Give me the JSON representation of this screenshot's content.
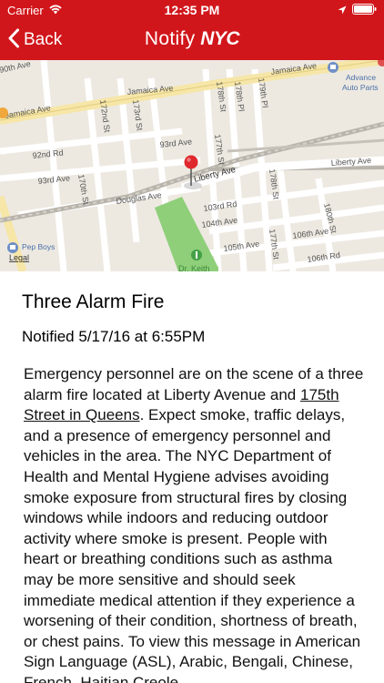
{
  "status": {
    "carrier": "Carrier",
    "time": "12:35 PM"
  },
  "nav": {
    "back_label": "Back",
    "title_light": "Notify",
    "title_bold": "NYC"
  },
  "map": {
    "labels": {
      "jamaica_ave_top": "Jamaica Ave",
      "jamaica_ave_mid": "Jamaica Ave",
      "jamaica_ave_left": "Jamaica Ave",
      "ave_90th": "90th Ave",
      "rd_92nd": "92nd Rd",
      "ave_93rd_left": "93rd Ave",
      "ave_93rd_mid": "93rd Ave",
      "douglas_ave": "Douglas Ave",
      "liberty_ave_mid": "Liberty Ave",
      "liberty_ave_right": "Liberty Ave",
      "st_170th": "170th St",
      "st_172nd": "172nd St",
      "st_173rd": "173rd St",
      "st_177th": "177th St",
      "st_178th": "178th St",
      "pl_178th": "178th Pl",
      "pl_179th": "179th Pl",
      "st_178th_lower": "178th St",
      "st_177th_lower": "177th St",
      "st_180th": "180th St",
      "ave_103rd": "103rd Rd",
      "ave_104th": "104th Ave",
      "ave_105th": "105th Ave",
      "ave_106th": "106th Ave",
      "rd_106th": "106th Rd",
      "poi_advance": "Advance Auto Parts",
      "poi_pepboys": "Pep Boys",
      "legal": "Legal",
      "park_partial": "Dr. Keith"
    }
  },
  "alert": {
    "title": "Three Alarm Fire",
    "notified": "Notified 5/17/16 at 6:55PM",
    "body_before_link": "Emergency personnel are on the scene of a three alarm fire located at Liberty Avenue and ",
    "body_link": "175th Street in Queens",
    "body_after_link": ". Expect smoke, traffic delays, and a presence of emergency personnel and vehicles in the area. The NYC Department of Health and Mental Hygiene advises avoiding smoke exposure from structural fires by closing windows while indoors and reducing outdoor activity where smoke is present. People with heart or breathing conditions such as asthma may be more sensitive and should seek immediate medical attention if they experience a worsening of their condition, shortness of breath, or chest pains. To view this message in American Sign Language (ASL), Arabic, Bengali, Chinese, French, Haitian Creole"
  },
  "colors": {
    "brand_red": "#d1161b",
    "map_bg": "#ede9e1",
    "park_green": "#8fcf7a",
    "pin_red": "#e0292e"
  }
}
